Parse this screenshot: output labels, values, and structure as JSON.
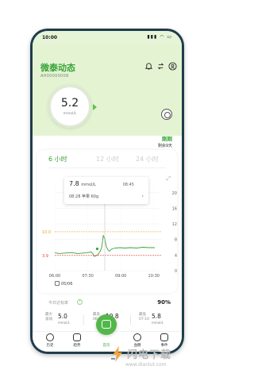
{
  "status_bar": {
    "time": "10:00",
    "icons": "▮▮▮ ◠ ▭"
  },
  "header": {
    "title": "微泰动态",
    "device_id": "AH00000008",
    "bell_icon": "bell-icon",
    "sync_icon": "sync-icon",
    "user_icon": "user-icon"
  },
  "gauge": {
    "value": "5.2",
    "unit": "mmol/L"
  },
  "sensor": {
    "status": "刚刚",
    "remaining": "剩余9天"
  },
  "tabs": [
    "6 小时",
    "12 小时",
    "24 小时"
  ],
  "tooltip": {
    "value": "7.8",
    "unit": "mmol/L",
    "time": "08:45",
    "event": "08:28 苹果 60g"
  },
  "chart_data": {
    "type": "line",
    "x_ticks": [
      "06:00",
      "07:30",
      "09:00",
      "10:30"
    ],
    "y_ticks": [
      "20",
      "16",
      "12",
      "8",
      "4",
      "0"
    ],
    "ylim": [
      0,
      22
    ],
    "upper_limit": {
      "label": "10.0",
      "value": 10.0
    },
    "lower_limit": {
      "label": "3.9",
      "value": 3.9
    },
    "series": [
      {
        "x": [
          0,
          6,
          12,
          18,
          24,
          30,
          36,
          42,
          48,
          50,
          52,
          54,
          56,
          58,
          60,
          62,
          64,
          66,
          68,
          70,
          72,
          74,
          76,
          80,
          86,
          92,
          100,
          108,
          116,
          124,
          132
        ],
        "values": [
          4.6,
          4.4,
          4.5,
          4.6,
          4.6,
          4.4,
          4.5,
          4.6,
          4.8,
          4.4,
          3.7,
          3.8,
          4.0,
          4.4,
          5.0,
          6.0,
          9.0,
          8.2,
          6.2,
          5.4,
          5.0,
          5.4,
          5.6,
          5.8,
          5.9,
          5.8,
          5.9,
          5.8,
          6.0,
          5.9,
          5.9
        ]
      }
    ],
    "marker_event": {
      "x": 56,
      "value": 5.6
    },
    "cursor": {
      "x": 66
    }
  },
  "chart_date": "05/06",
  "tir": {
    "label": "今日达标率",
    "help": "?",
    "value": "90%"
  },
  "stats": [
    {
      "label": "最大\n波动",
      "value": "5.0",
      "unit": "mmol/L"
    },
    {
      "label": "最高\n06:50",
      "value": "10.8",
      "unit": "mmol/L"
    },
    {
      "label": "最低\n07:10",
      "value": "5.8",
      "unit": "mmol/L"
    }
  ],
  "nav": [
    {
      "label": "历史",
      "icon": "history-icon"
    },
    {
      "label": "趋势",
      "icon": "trend-icon"
    },
    {
      "label": "首页",
      "icon": "home-icon"
    },
    {
      "label": "血糖",
      "icon": "blood-drop-icon"
    },
    {
      "label": "事件",
      "icon": "event-icon"
    }
  ],
  "watermark": {
    "name": "闪电下载",
    "url": "www.dianlut.com"
  },
  "colors": {
    "accent": "#3aa33a",
    "header_bg": "#e4f4d3",
    "high_line": "#f2a33c",
    "low_line": "#e6483d",
    "curve": "#3aa33a"
  }
}
